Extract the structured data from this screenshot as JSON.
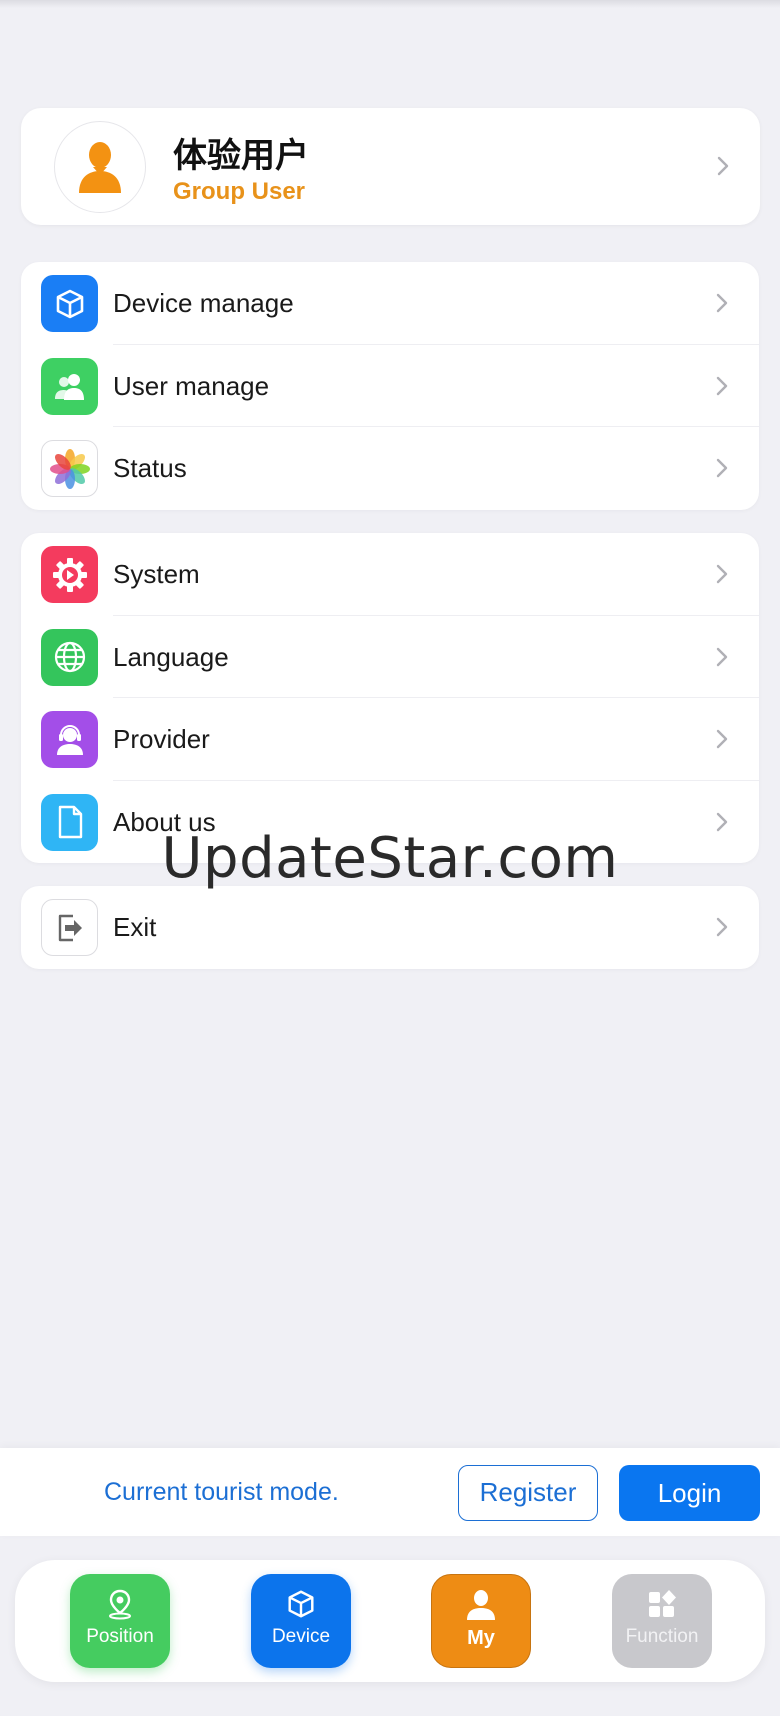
{
  "profile": {
    "name": "体验用户",
    "role": "Group User"
  },
  "menu_groups": [
    {
      "items": [
        {
          "label": "Device manage",
          "icon": "cube-icon",
          "color": "#1a7ef5"
        },
        {
          "label": "User manage",
          "icon": "users-icon",
          "color": "#3ed063"
        },
        {
          "label": "Status",
          "icon": "photos-flower-icon",
          "color": "#ffffff"
        }
      ]
    },
    {
      "items": [
        {
          "label": "System",
          "icon": "gear-icon",
          "color": "#f43b5e"
        },
        {
          "label": "Language",
          "icon": "globe-icon",
          "color": "#34c55c"
        },
        {
          "label": "Provider",
          "icon": "headset-person-icon",
          "color": "#a34ee8"
        },
        {
          "label": "About us",
          "icon": "document-icon",
          "color": "#2fb5f5"
        }
      ]
    },
    {
      "items": [
        {
          "label": "Exit",
          "icon": "exit-icon",
          "color": "#ffffff"
        }
      ]
    }
  ],
  "watermark": "UpdateStar.com",
  "tourist_bar": {
    "message": "Current tourist mode.",
    "register_label": "Register",
    "login_label": "Login"
  },
  "bottom_nav": {
    "items": [
      {
        "label": "Position",
        "icon": "location-pin-icon",
        "color": "#45cc60"
      },
      {
        "label": "Device",
        "icon": "cube-icon",
        "color": "#0c74ec"
      },
      {
        "label": "My",
        "icon": "person-icon",
        "color": "#ee8c14",
        "active": true
      },
      {
        "label": "Function",
        "icon": "apps-grid-icon",
        "color": "#c8c8cc"
      }
    ]
  }
}
